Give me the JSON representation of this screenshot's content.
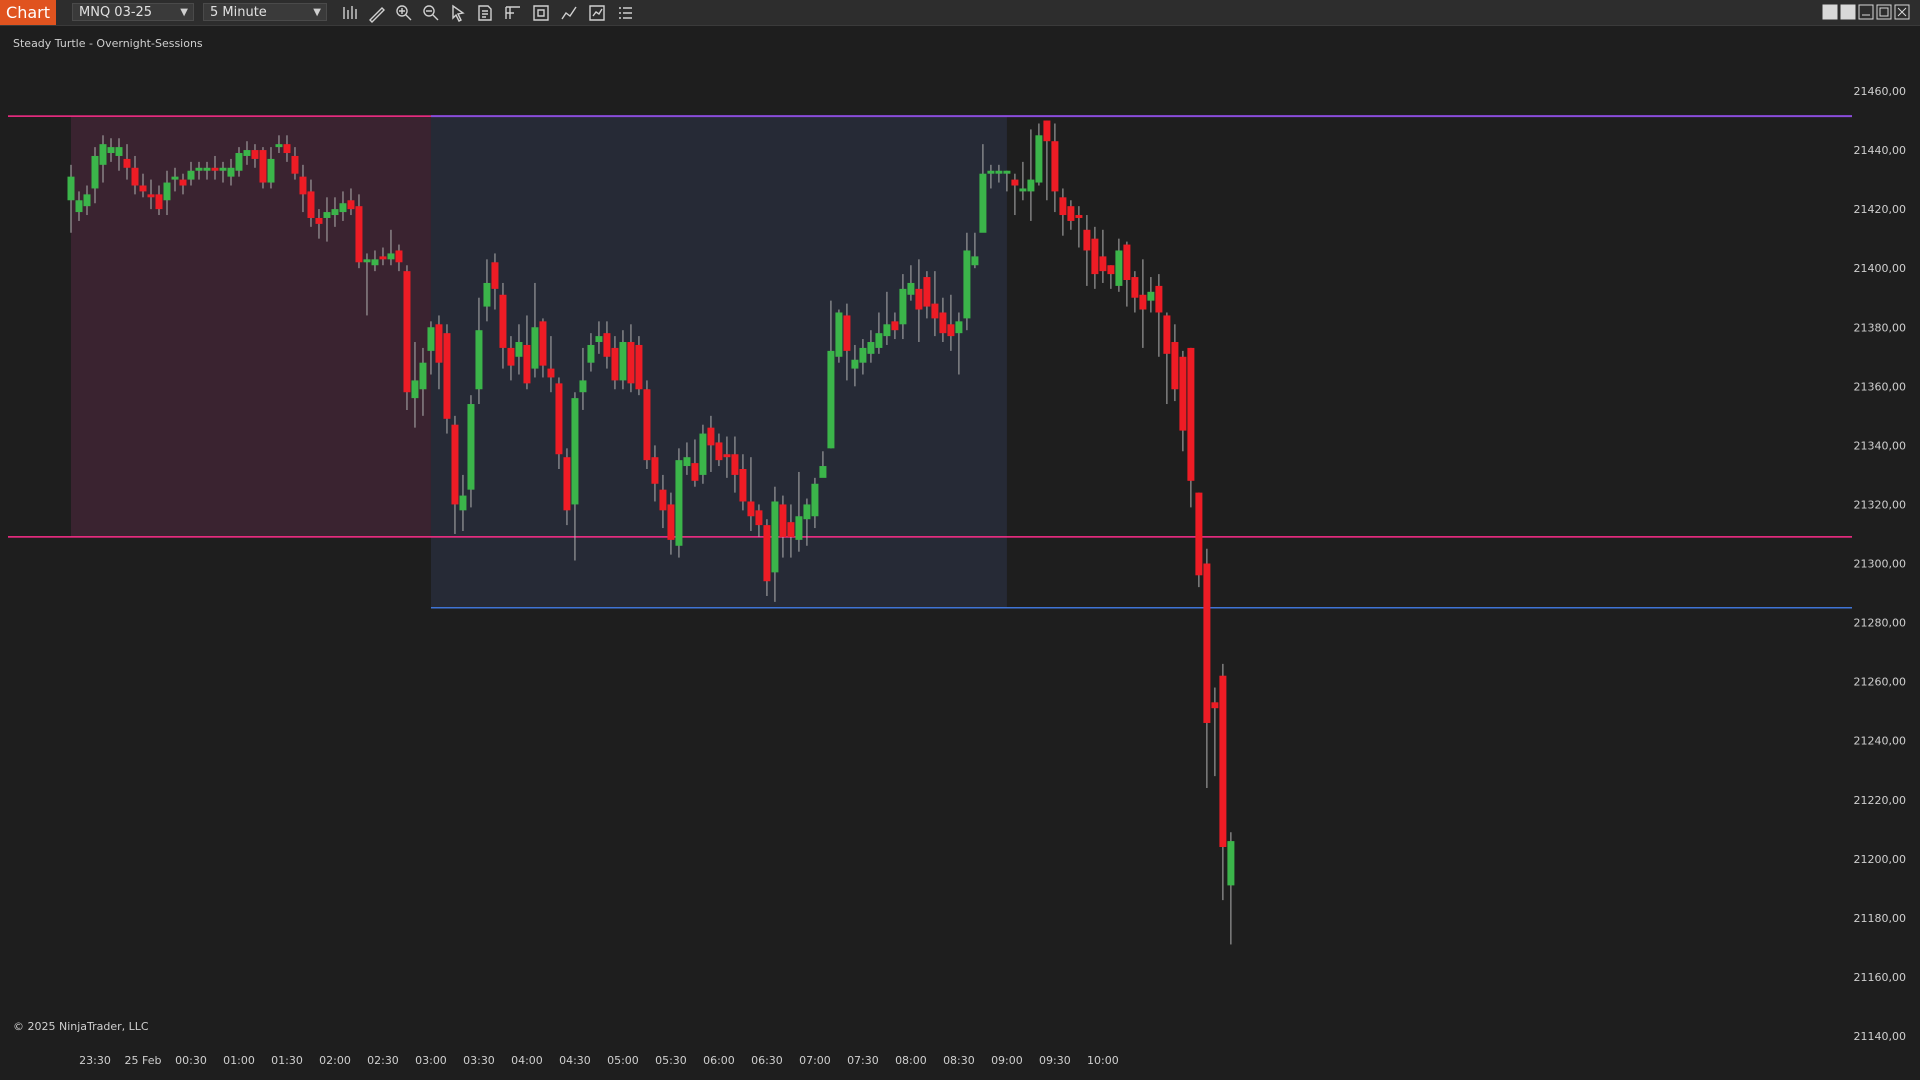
{
  "toolbar": {
    "chart_tab": "Chart",
    "instrument": "MNQ 03-25",
    "interval": "5 Minute",
    "tools": [
      "bar-style-icon",
      "draw-icon",
      "zoom-in-icon",
      "zoom-out-icon",
      "pointer-icon",
      "data-box-icon",
      "properties-icon",
      "time-frame-icon",
      "strategy-icon",
      "indicators-icon",
      "list-icon"
    ],
    "window_buttons": [
      "tile-icon",
      "tile-alt-icon",
      "minimize-icon",
      "maximize-icon",
      "close-icon"
    ]
  },
  "chart": {
    "indicator_label": "Steady Turtle - Overnight-Sessions",
    "copyright": "© 2025 NinjaTrader, LLC",
    "price_ticks": [
      "21460,00",
      "21440,00",
      "21420,00",
      "21400,00",
      "21380,00",
      "21360,00",
      "21340,00",
      "21320,00",
      "21300,00",
      "21280,00",
      "21260,00",
      "21240,00",
      "21220,00",
      "21200,00",
      "21180,00",
      "21160,00",
      "21140,00"
    ],
    "time_ticks": [
      "23:30",
      "25 Feb",
      "00:30",
      "01:00",
      "01:30",
      "02:00",
      "02:30",
      "03:00",
      "03:30",
      "04:00",
      "04:30",
      "05:00",
      "05:30",
      "06:00",
      "06:30",
      "07:00",
      "07:30",
      "08:00",
      "08:30",
      "09:00",
      "09:30",
      "10:00"
    ]
  },
  "colors": {
    "up_candle": "#3bb54a",
    "down_candle": "#ee1c25",
    "wick": "#b0b0b0",
    "session_1_fill": "#3a2330",
    "session_2_fill": "#262a36",
    "session_1_line": "#ff2d8a",
    "session_2_high_line": "#8a4ddb",
    "session_2_low_line": "#3f74d6",
    "background": "#1e1e1e"
  },
  "chart_data": {
    "type": "candlestick",
    "instrument": "MNQ 03-25",
    "interval": "5 Minute",
    "y_range": [
      21140,
      21460
    ],
    "x_range": [
      "23:15",
      "10:15"
    ],
    "sessions": [
      {
        "start": "23:15",
        "end": "03:00",
        "high": 21451.5,
        "low": 21309
      },
      {
        "start": "03:00",
        "end": "09:00",
        "high": 21451.5,
        "low": 21285
      }
    ],
    "candles": [
      [
        21423,
        21431,
        21412,
        21435
      ],
      [
        21419,
        21423,
        21416,
        21426
      ],
      [
        21421,
        21425,
        21418,
        21428
      ],
      [
        21427,
        21438,
        21422,
        21441
      ],
      [
        21435,
        21442,
        21429,
        21445
      ],
      [
        21439,
        21441,
        21436,
        21444
      ],
      [
        21438,
        21441,
        21433,
        21444
      ],
      [
        21437,
        21434,
        21430,
        21442
      ],
      [
        21434,
        21428,
        21425,
        21438
      ],
      [
        21428,
        21426,
        21424,
        21432
      ],
      [
        21425,
        21424,
        21420,
        21430
      ],
      [
        21425,
        21420,
        21418,
        21428
      ],
      [
        21423,
        21429,
        21418,
        21433
      ],
      [
        21430,
        21431,
        21426,
        21434
      ],
      [
        21430,
        21428,
        21425,
        21432
      ],
      [
        21430,
        21433,
        21428,
        21436
      ],
      [
        21433,
        21434,
        21430,
        21436
      ],
      [
        21433,
        21434,
        21430,
        21436
      ],
      [
        21434,
        21433,
        21430,
        21438
      ],
      [
        21433,
        21434,
        21429,
        21436
      ],
      [
        21431,
        21434,
        21428,
        21437
      ],
      [
        21433,
        21439,
        21431,
        21441
      ],
      [
        21438,
        21440,
        21435,
        21443
      ],
      [
        21440,
        21437,
        21434,
        21442
      ],
      [
        21440,
        21429,
        21427,
        21441
      ],
      [
        21429,
        21437,
        21427,
        21441
      ],
      [
        21441,
        21442,
        21439,
        21445
      ],
      [
        21442,
        21439,
        21436,
        21445
      ],
      [
        21438,
        21432,
        21430,
        21441
      ],
      [
        21431,
        21425,
        21419,
        21435
      ],
      [
        21426,
        21417,
        21414,
        21430
      ],
      [
        21417,
        21415,
        21410,
        21420
      ],
      [
        21417,
        21419,
        21409,
        21424
      ],
      [
        21418,
        21420,
        21414,
        21424
      ],
      [
        21419,
        21422,
        21416,
        21426
      ],
      [
        21423,
        21420,
        21418,
        21427
      ],
      [
        21421,
        21402,
        21400,
        21425
      ],
      [
        21402,
        21403,
        21384,
        21405
      ],
      [
        21401,
        21403,
        21399,
        21406
      ],
      [
        21404,
        21403,
        21401,
        21407
      ],
      [
        21403,
        21405,
        21401,
        21413
      ],
      [
        21406,
        21402,
        21399,
        21408
      ],
      [
        21399,
        21358,
        21352,
        21401
      ],
      [
        21356,
        21362,
        21346,
        21375
      ],
      [
        21359,
        21368,
        21350,
        21373
      ],
      [
        21372,
        21380,
        21364,
        21382
      ],
      [
        21381,
        21368,
        21359,
        21384
      ],
      [
        21378,
        21349,
        21344,
        21381
      ],
      [
        21347,
        21320,
        21310,
        21350
      ],
      [
        21318,
        21323,
        21311,
        21330
      ],
      [
        21325,
        21354,
        21319,
        21357
      ],
      [
        21359,
        21379,
        21354,
        21390
      ],
      [
        21387,
        21395,
        21382,
        21403
      ],
      [
        21402,
        21393,
        21386,
        21405
      ],
      [
        21391,
        21373,
        21366,
        21395
      ],
      [
        21373,
        21367,
        21362,
        21377
      ],
      [
        21370,
        21375,
        21364,
        21381
      ],
      [
        21374,
        21361,
        21359,
        21384
      ],
      [
        21366,
        21380,
        21363,
        21395
      ],
      [
        21382,
        21367,
        21363,
        21383
      ],
      [
        21366,
        21363,
        21358,
        21377
      ],
      [
        21361,
        21337,
        21332,
        21363
      ],
      [
        21336,
        21318,
        21313,
        21339
      ],
      [
        21320,
        21356,
        21301,
        21358
      ],
      [
        21358,
        21362,
        21352,
        21373
      ],
      [
        21368,
        21374,
        21365,
        21378
      ],
      [
        21375,
        21377,
        21371,
        21382
      ],
      [
        21378,
        21370,
        21366,
        21382
      ],
      [
        21373,
        21362,
        21359,
        21377
      ],
      [
        21362,
        21375,
        21359,
        21379
      ],
      [
        21375,
        21361,
        21358,
        21381
      ],
      [
        21374,
        21359,
        21357,
        21377
      ],
      [
        21359,
        21335,
        21332,
        21362
      ],
      [
        21336,
        21327,
        21321,
        21340
      ],
      [
        21325,
        21318,
        21312,
        21330
      ],
      [
        21320,
        21308,
        21303,
        21324
      ],
      [
        21306,
        21335,
        21302,
        21339
      ],
      [
        21333,
        21336,
        21330,
        21341
      ],
      [
        21334,
        21328,
        21326,
        21342
      ],
      [
        21330,
        21344,
        21327,
        21347
      ],
      [
        21346,
        21340,
        21331,
        21350
      ],
      [
        21341,
        21335,
        21333,
        21344
      ],
      [
        21337,
        21336,
        21329,
        21343
      ],
      [
        21337,
        21330,
        21324,
        21343
      ],
      [
        21332,
        21321,
        21318,
        21337
      ],
      [
        21321,
        21316,
        21311,
        21336
      ],
      [
        21318,
        21313,
        21309,
        21320
      ],
      [
        21313,
        21294,
        21289,
        21315
      ],
      [
        21297,
        21321,
        21287,
        21326
      ],
      [
        21320,
        21309,
        21302,
        21323
      ],
      [
        21314,
        21309,
        21302,
        21320
      ],
      [
        21308,
        21316,
        21304,
        21331
      ],
      [
        21315,
        21320,
        21306,
        21322
      ],
      [
        21316,
        21327,
        21312,
        21329
      ],
      [
        21329,
        21333,
        21330,
        21338
      ],
      [
        21339,
        21372,
        21339,
        21389
      ],
      [
        21370,
        21385,
        21368,
        21386
      ],
      [
        21384,
        21372,
        21362,
        21388
      ],
      [
        21366,
        21369,
        21360,
        21374
      ],
      [
        21368,
        21373,
        21364,
        21376
      ],
      [
        21371,
        21375,
        21368,
        21379
      ],
      [
        21373,
        21378,
        21371,
        21385
      ],
      [
        21377,
        21381,
        21374,
        21392
      ],
      [
        21382,
        21379,
        21376,
        21385
      ],
      [
        21381,
        21393,
        21376,
        21398
      ],
      [
        21391,
        21395,
        21389,
        21401
      ],
      [
        21393,
        21386,
        21375,
        21403
      ],
      [
        21397,
        21387,
        21383,
        21399
      ],
      [
        21388,
        21383,
        21377,
        21399
      ],
      [
        21385,
        21378,
        21375,
        21390
      ],
      [
        21381,
        21377,
        21372,
        21391
      ],
      [
        21378,
        21382,
        21364,
        21385
      ],
      [
        21383,
        21406,
        21379,
        21412
      ],
      [
        21401,
        21404,
        21400,
        21412
      ],
      [
        21412,
        21432,
        21413,
        21442
      ],
      [
        21432,
        21433,
        21427,
        21435
      ],
      [
        21432,
        21433,
        21429,
        21435
      ],
      [
        21432,
        21433,
        21426,
        21433
      ],
      [
        21430,
        21428,
        21418,
        21432
      ],
      [
        21426,
        21427,
        21423,
        21436
      ],
      [
        21426,
        21430,
        21416,
        21447
      ],
      [
        21429,
        21445,
        21428,
        21449
      ],
      [
        21450,
        21443,
        21423,
        21450
      ],
      [
        21443,
        21426,
        21419,
        21449
      ],
      [
        21424,
        21418,
        21411,
        21427
      ],
      [
        21421,
        21416,
        21413,
        21423
      ],
      [
        21418,
        21417,
        21407,
        21421
      ],
      [
        21413,
        21406,
        21394,
        21418
      ],
      [
        21410,
        21398,
        21393,
        21414
      ],
      [
        21404,
        21399,
        21395,
        21413
      ],
      [
        21401,
        21398,
        21393,
        21401
      ],
      [
        21394,
        21406,
        21392,
        21410
      ],
      [
        21408,
        21396,
        21387,
        21409
      ],
      [
        21397,
        21390,
        21385,
        21399
      ],
      [
        21391,
        21386,
        21373,
        21403
      ],
      [
        21389,
        21392,
        21385,
        21397
      ],
      [
        21394,
        21385,
        21370,
        21398
      ],
      [
        21384,
        21371,
        21354,
        21385
      ],
      [
        21375,
        21359,
        21355,
        21381
      ],
      [
        21370,
        21345,
        21338,
        21372
      ],
      [
        21373,
        21328,
        21319,
        21373
      ],
      [
        21324,
        21296,
        21292,
        21324
      ],
      [
        21300,
        21246,
        21224,
        21305
      ],
      [
        21253,
        21251,
        21228,
        21258
      ],
      [
        21262,
        21204,
        21186,
        21266
      ],
      [
        21191,
        21206,
        21171,
        21209
      ]
    ],
    "candle_format": [
      "open",
      "close",
      "low",
      "high"
    ],
    "horizontal_lines": [
      {
        "name": "session-1-high",
        "price": 21451.5
      },
      {
        "name": "session-1-low",
        "price": 21309
      },
      {
        "name": "session-2-high",
        "price": 21451.5
      },
      {
        "name": "session-2-low",
        "price": 21285
      }
    ]
  }
}
